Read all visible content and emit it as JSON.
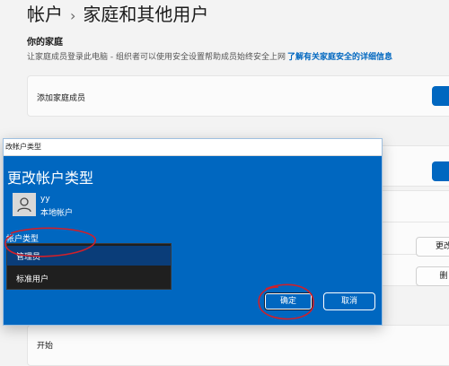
{
  "header": {
    "parent": "帐户",
    "separator": "›",
    "title": "家庭和其他用户"
  },
  "family": {
    "section_title": "你的家庭",
    "description": "让家庭成员登录此电脑 - 组织者可以使用安全设置帮助成员始终安全上网",
    "link": "了解有关家庭安全的详细信息",
    "add_member_label": "添加家庭成员"
  },
  "other_users": {
    "partial_buttons": [
      "更改",
      "删"
    ]
  },
  "kiosk": {
    "start_label": "开始"
  },
  "dialog": {
    "titlebar": "改帐户类型",
    "heading": "更改帐户类型",
    "user_name": "yy",
    "user_type": "本地帐户",
    "account_type_label": "帐户类型",
    "options": [
      "管理员",
      "标准用户"
    ],
    "selected_option": "管理员",
    "ok_label": "确定",
    "cancel_label": "取消"
  },
  "colors": {
    "accent": "#0067c0",
    "dialog_bg": "#0067c0",
    "annotation": "#d0202a"
  },
  "icons": {
    "avatar": "person-icon",
    "breadcrumb": "chevron-right-icon"
  }
}
